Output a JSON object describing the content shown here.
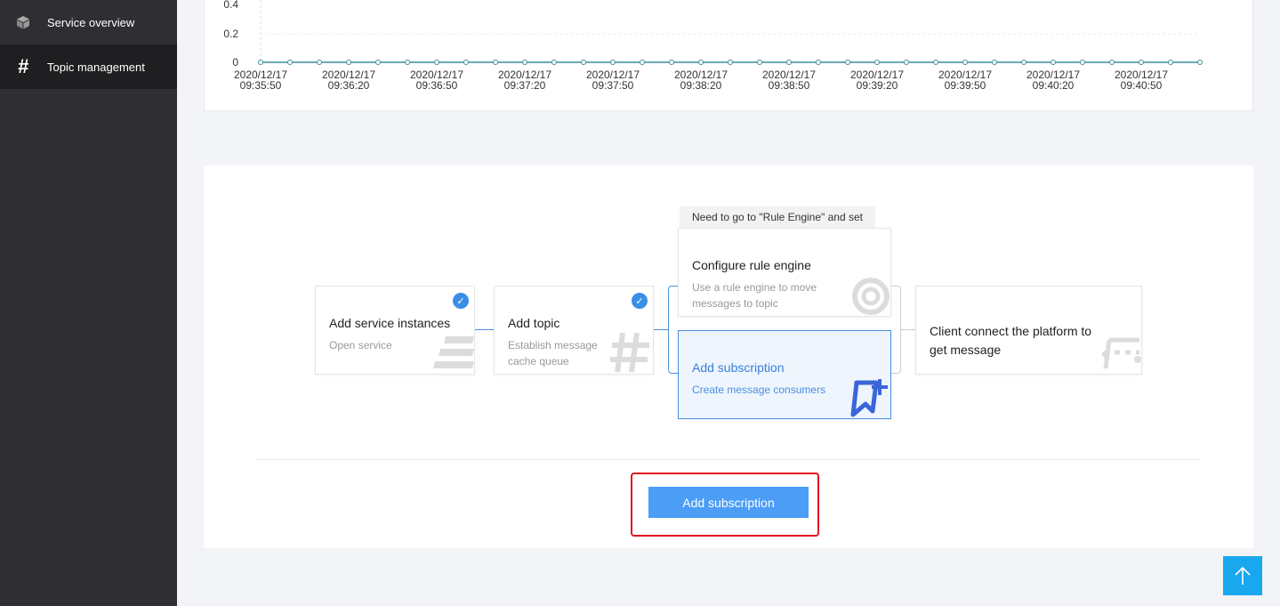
{
  "sidebar": {
    "items": [
      {
        "label": "Service overview",
        "icon": "cube-icon"
      },
      {
        "label": "Topic management",
        "icon": "hash-icon"
      }
    ]
  },
  "chart_data": {
    "type": "line",
    "y_ticks": [
      "0.4",
      "0.2",
      "0"
    ],
    "x_ticks": [
      [
        "2020/12/17",
        "09:35:50"
      ],
      [
        "2020/12/17",
        "09:36:20"
      ],
      [
        "2020/12/17",
        "09:36:50"
      ],
      [
        "2020/12/17",
        "09:37:20"
      ],
      [
        "2020/12/17",
        "09:37:50"
      ],
      [
        "2020/12/17",
        "09:38:20"
      ],
      [
        "2020/12/17",
        "09:38:50"
      ],
      [
        "2020/12/17",
        "09:39:20"
      ],
      [
        "2020/12/17",
        "09:39:50"
      ],
      [
        "2020/12/17",
        "09:40:20"
      ],
      [
        "2020/12/17",
        "09:40:50"
      ]
    ],
    "series": [
      {
        "values": [
          0,
          0,
          0,
          0,
          0,
          0,
          0,
          0,
          0,
          0,
          0,
          0,
          0,
          0,
          0,
          0,
          0,
          0,
          0,
          0,
          0,
          0,
          0,
          0,
          0,
          0,
          0,
          0,
          0,
          0,
          0,
          0,
          0
        ]
      }
    ],
    "point_interval_seconds": 10,
    "color": "#3f8f99"
  },
  "flow": {
    "tip": "Need to go to \"Rule Engine\" and set",
    "steps": [
      {
        "title": "Add service instances",
        "desc": "Open service",
        "done": true
      },
      {
        "title": "Add topic",
        "desc": "Establish message cache queue",
        "done": true
      },
      {
        "title": "Configure rule engine",
        "desc": "Use a rule engine to move messages to topic"
      },
      {
        "title": "Add subscription",
        "desc": "Create message consumers"
      },
      {
        "title": "Client connect the platform to get message",
        "desc": ""
      }
    ],
    "button_label": "Add subscription"
  },
  "colors": {
    "accent": "#4a90e2",
    "button": "#4c9df5",
    "highlight": "#e0141e",
    "sidebar": "#2f2f33"
  }
}
